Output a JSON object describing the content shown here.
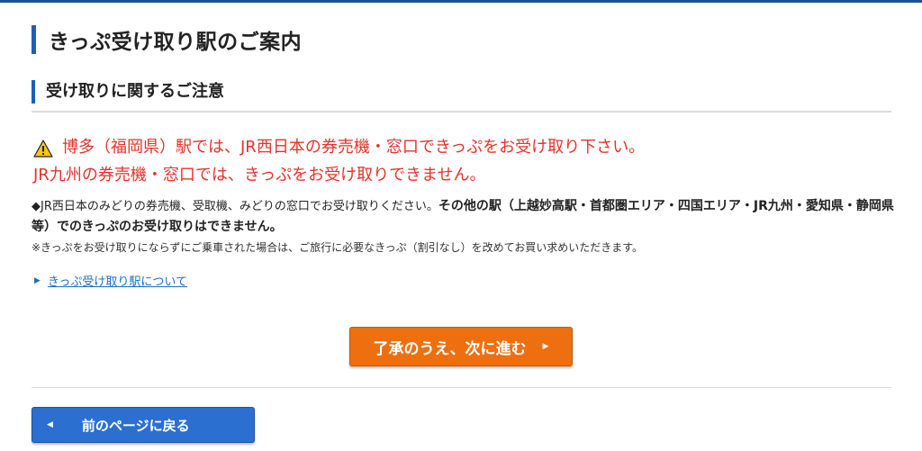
{
  "page_title": "きっぷ受け取り駅のご案内",
  "section_title": "受け取りに関するご注意",
  "warning": {
    "line1": "博多（福岡県）駅では、JR西日本の券売機・窓口できっぷをお受け取り下さい。",
    "line2": "JR九州の券売機・窓口では、きっぷをお受け取りできません。",
    "icon": "warning-triangle-icon",
    "color": "#e8312a"
  },
  "notice": {
    "normal": "◆JR西日本のみどりの券売機、受取機、みどりの窓口でお受け取りください。",
    "bold": "その他の駅（上越妙高駅・首都圏エリア・四国エリア・JR九州・愛知県・静岡県　等）でのきっぷのお受け取りはできません。"
  },
  "small_note": "※きっぷをお受け取りにならずにご乗車された場合は、ご旅行に必要なきっぷ（割引なし）を改めてお買い求めいただきます。",
  "link_label": "きっぷ受け取り駅について",
  "next_button": {
    "label": "了承のうえ、次に進む",
    "color": "#ee6f10"
  },
  "back_button": {
    "label": "前のページに戻る",
    "color": "#2b6fd0"
  },
  "accent_color": "#1e5fb8"
}
